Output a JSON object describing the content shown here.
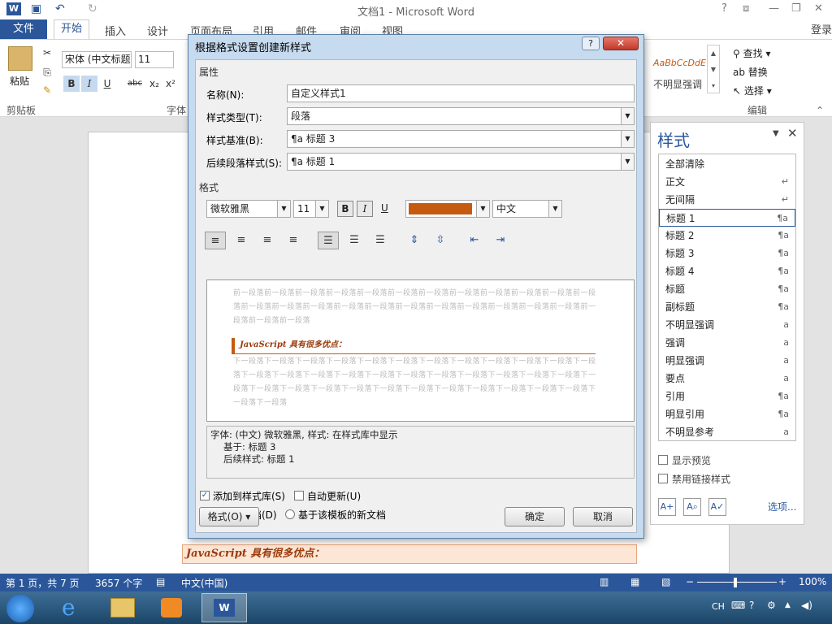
{
  "window": {
    "title": "文档1 - Microsoft Word",
    "help": "?",
    "login": "登录"
  },
  "ribbon_tabs": [
    "文件",
    "开始",
    "插入",
    "设计",
    "页面布局",
    "引用",
    "邮件",
    "审阅",
    "视图"
  ],
  "ribbon": {
    "paste_label": "粘贴",
    "clipboard_label": "剪贴板",
    "font_name": "宋体 (中文标题",
    "font_size": "11",
    "font_group_label": "字体",
    "style_preview": "AaBbCcDdE",
    "style_preview_name": "不明显强调",
    "find_label": "查找",
    "replace_label": "替换",
    "select_label": "选择",
    "edit_group_label": "编辑"
  },
  "styles_pane": {
    "title": "样式",
    "items": [
      {
        "name": "全部清除",
        "mark": ""
      },
      {
        "name": "正文",
        "mark": "↵"
      },
      {
        "name": "无间隔",
        "mark": "↵"
      },
      {
        "name": "标题 1",
        "mark": "¶a"
      },
      {
        "name": "标题 2",
        "mark": "¶a"
      },
      {
        "name": "标题 3",
        "mark": "¶a"
      },
      {
        "name": "标题 4",
        "mark": "¶a"
      },
      {
        "name": "标题",
        "mark": "¶a"
      },
      {
        "name": "副标题",
        "mark": "¶a"
      },
      {
        "name": "不明显强调",
        "mark": "a"
      },
      {
        "name": "强调",
        "mark": "a"
      },
      {
        "name": "明显强调",
        "mark": "a"
      },
      {
        "name": "要点",
        "mark": "a"
      },
      {
        "name": "引用",
        "mark": "¶a"
      },
      {
        "name": "明显引用",
        "mark": "¶a"
      },
      {
        "name": "不明显参考",
        "mark": "a"
      }
    ],
    "show_preview": "显示预览",
    "disable_linked": "禁用链接样式",
    "options": "选项..."
  },
  "document": {
    "bottom_line": "JavaScript 具有很多优点："
  },
  "dialog": {
    "title": "根据格式设置创建新样式",
    "help": "?",
    "properties_header": "属性",
    "name_label": "名称(N):",
    "name_value": "自定义样式1",
    "type_label": "样式类型(T):",
    "type_value": "段落",
    "base_label": "样式基准(B):",
    "base_value": "¶a 标题 3",
    "next_label": "后续段落样式(S):",
    "next_value": "¶a 标题 1",
    "format_header": "格式",
    "font_value": "微软雅黑",
    "size_value": "11",
    "bold": "B",
    "italic": "I",
    "underline": "U",
    "color": "#c55a11",
    "script_value": "中文",
    "preview_prev": "前一段落前一段落前一段落前一段落前一段落前一段落前一段落前一段落前一段落前一段落前一段落前一段落前一段落前一段落前一段落前一段落前一段落前一段落前一段落前一段落前一段落前一段落前一段落前一段落前一段落前一段落",
    "preview_sample": "JavaScript 具有很多优点：",
    "preview_next": "下一段落下一段落下一段落下一段落下一段落下一段落下一段落下一段落下一段落下一段落下一段落下一段落下一段落下一段落下一段落下一段落下一段落下一段落下一段落下一段落下一段落下一段落下一段落下一段落下一段落下一段落下一段落下一段落下一段落下一段落下一段落下一段落下一段落下一段落下一段落下一段落下一段落",
    "desc_line1": "字体: (中文) 微软雅黑, 样式: 在样式库中显示",
    "desc_line2": "基于: 标题 3",
    "desc_line3": "后续样式: 标题 1",
    "add_to_gallery": "添加到样式库(S)",
    "auto_update": "自动更新(U)",
    "only_this_doc": "仅限此文档(D)",
    "new_docs_template": "基于该模板的新文档",
    "format_button": "格式(O) ▾",
    "ok": "确定",
    "cancel": "取消"
  },
  "status_bar": {
    "page": "第 1 页，共 7 页",
    "words": "3657 个字",
    "language": "中文(中国)",
    "zoom": "100%"
  },
  "taskbar": {
    "tray_lang": "CH"
  }
}
